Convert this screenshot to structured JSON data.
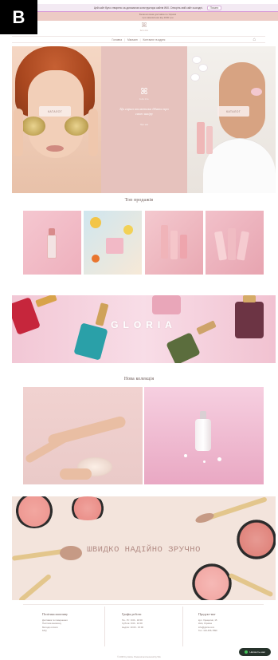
{
  "corner_label": "B",
  "announcement": {
    "text": "Цей сайт було створено за допомогою конструктора сайтів WIX. Створіть свій сайт сьогодні.",
    "cta": "Почати"
  },
  "promo": {
    "line1": "Безкоштовна доставка по Україні",
    "line2": "при замовленні від 1000 грн"
  },
  "logo": {
    "mark": "ꕤ",
    "word": "Gloria"
  },
  "nav": {
    "items": [
      "Головна",
      "Магазин",
      "Контакти та адрес"
    ],
    "cart_icon": "bag-icon"
  },
  "hero": {
    "left_button": "КАТАЛОГ",
    "right_button": "КАТАЛОГ",
    "center_mark": "ꕤ",
    "center_word": "Gloria",
    "slogan": "Ця гарна косметика дбати про свою шкіру",
    "sub": "Про нас"
  },
  "top_sales": {
    "title": "Топ продажів"
  },
  "banner": {
    "word": "GLORIA"
  },
  "new_collection": {
    "title": "Нова колекція"
  },
  "makeup_banner": {
    "tagline": "ШВИДКО НАДІЙНО ЗРУЧНО"
  },
  "footer": {
    "columns": [
      {
        "title": "Політика магазину",
        "lines": [
          "Доставка та повернення",
          "Політика магазину",
          "Методи оплати",
          "FAQ"
        ]
      },
      {
        "title": "Графік роботи",
        "lines": [
          "Пн - Пт: 9:00 - 18:00",
          "Субота: 9:00 - 16:00",
          "Неділя: 10:00 - 15:00"
        ]
      },
      {
        "title": "Продукт-маг",
        "lines": [
          "вул. Хрещатик, 15",
          "Київ, Україна",
          "info@gloria.com",
          "Тел: 123-456-7890"
        ]
      }
    ],
    "copyright": "© 2035 by Gloria. Powered and secured by Wix"
  },
  "chat": {
    "label": "Напишіть нам"
  },
  "colors": {
    "accent": "#e6c2bd",
    "banner": "#f2c7d5",
    "text": "#6a5754"
  }
}
